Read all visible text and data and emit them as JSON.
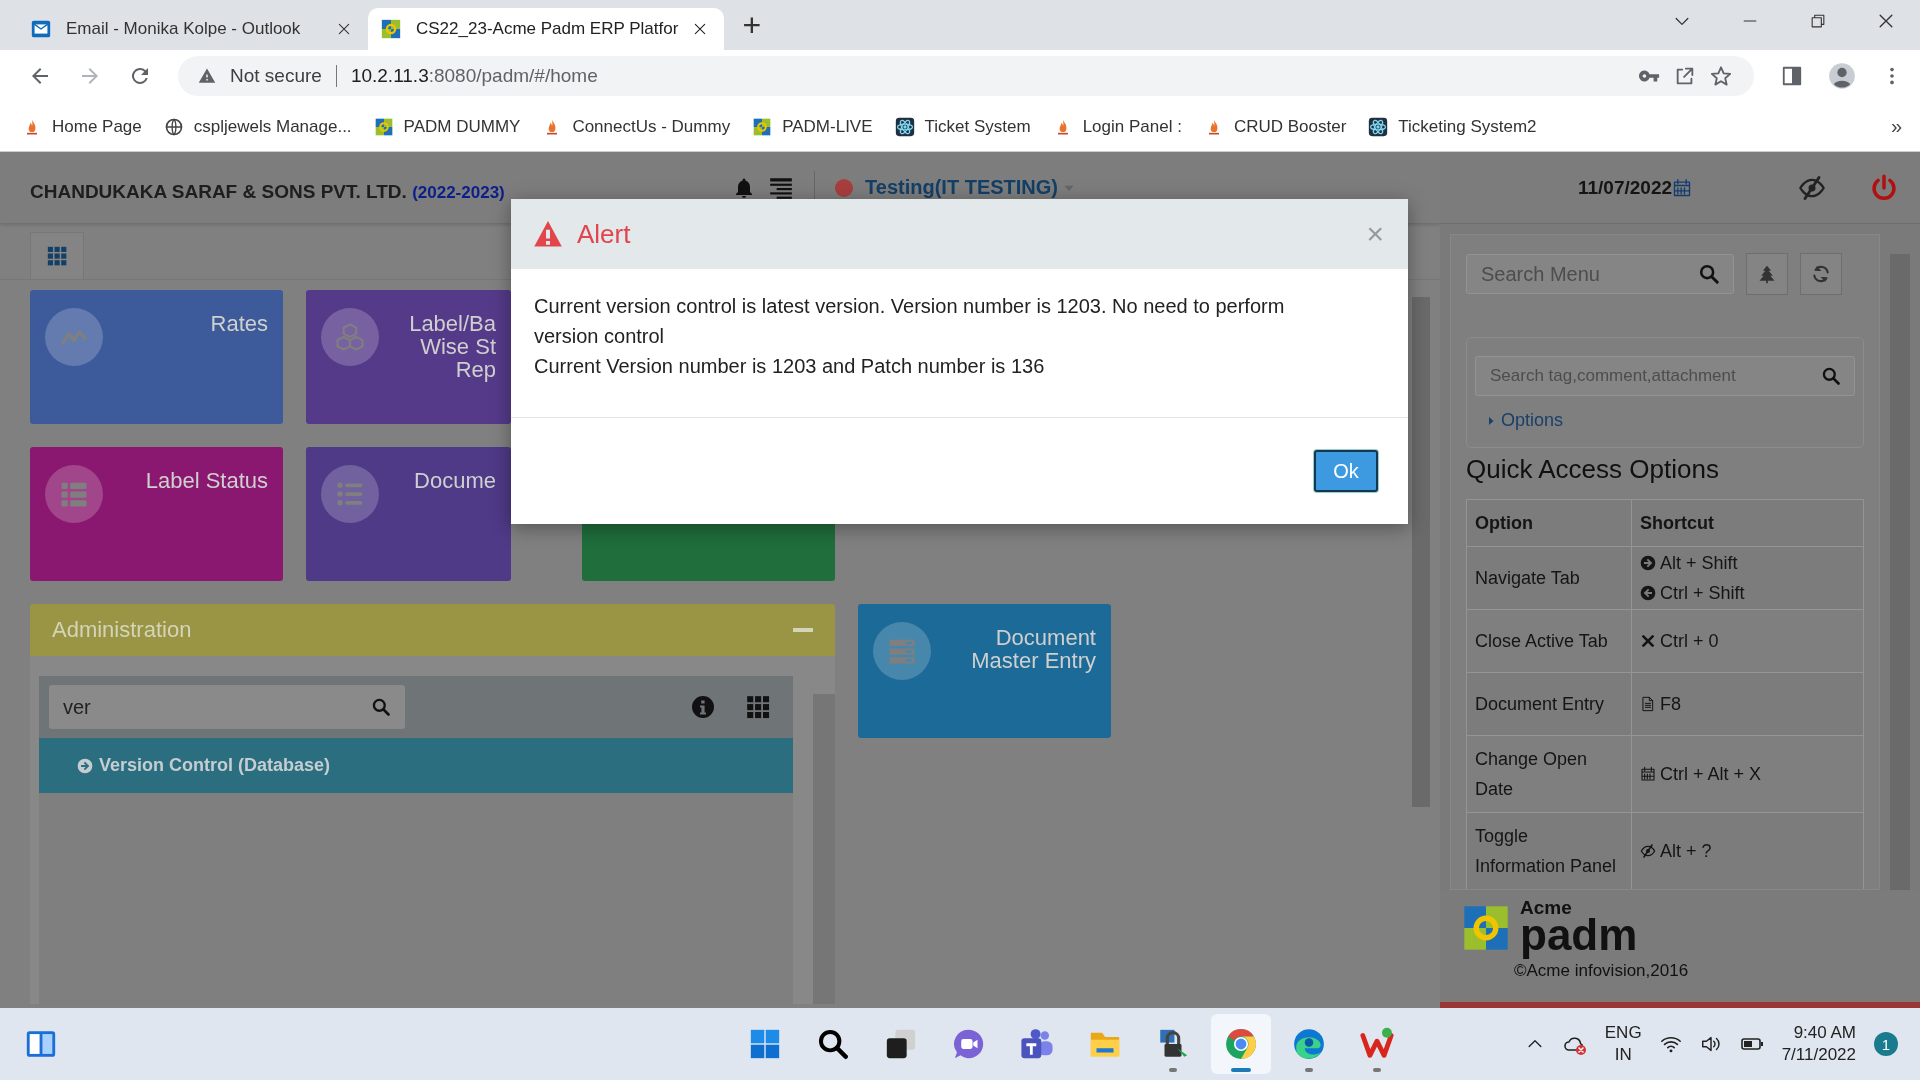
{
  "browser": {
    "tabs": [
      {
        "title": "Email - Monika Kolpe - Outlook",
        "kind": "mail",
        "selected": false
      },
      {
        "title": "CS22_23-Acme Padm ERP Platfor",
        "kind": "padm",
        "selected": true
      }
    ],
    "new_tab": "+",
    "security": "Not secure",
    "url_host": "10.2.11.3",
    "url_path": ":8080/padm/#/home",
    "bookmarks": [
      {
        "label": "Home Page",
        "kind": "flame"
      },
      {
        "label": "cspljewels Manage...",
        "kind": "globe"
      },
      {
        "label": "PADM DUMMY",
        "kind": "padm"
      },
      {
        "label": "ConnectUs - Dummy",
        "kind": "flame"
      },
      {
        "label": "PADM-LIVE",
        "kind": "padm"
      },
      {
        "label": "Ticket System",
        "kind": "atom"
      },
      {
        "label": "Login Panel :",
        "kind": "flame"
      },
      {
        "label": "CRUD Booster",
        "kind": "flame"
      },
      {
        "label": "Ticketing System2",
        "kind": "atom"
      }
    ],
    "more": "»"
  },
  "app": {
    "company": "CHANDUKAKA SARAF & SONS PVT. LTD.",
    "year": "(2022-2023)",
    "user": "Testing(IT TESTING)",
    "tile_rows": [
      [
        {
          "lines": [
            "Rates"
          ],
          "kind": "chart",
          "color": "#3d5b9a"
        },
        {
          "lines": [
            "Label/Ba",
            "Wise St",
            "Rep"
          ],
          "kind": "cubes",
          "color": "#553a89"
        }
      ],
      [
        {
          "lines": [
            "Label Status"
          ],
          "kind": "table",
          "color": "#8b1870"
        },
        {
          "lines": [
            "Docume"
          ],
          "kind": "bullets",
          "color": "#4e3a86"
        },
        {
          "kind": "none",
          "color": "#1f6e3b"
        }
      ]
    ],
    "admin": {
      "title": "Administration",
      "search_value": "ver",
      "items": [
        {
          "label": "Version Control (Database)"
        }
      ]
    },
    "side_tile": {
      "lines": [
        "Document",
        "Master Entry"
      ],
      "kind": "server",
      "color": "#1b6a98"
    }
  },
  "side": {
    "date": "11/07/2022",
    "menu_placeholder": "Search Menu",
    "tag_placeholder": "Search tag,comment,attachment",
    "options": "Options",
    "heading": "Quick Access Options",
    "columns": [
      "Option",
      "Shortcut"
    ],
    "rows": [
      {
        "option": "Navigate Tab",
        "shortcuts": [
          {
            "kind": "arrow-right",
            "keys": "Alt + Shift"
          },
          {
            "kind": "arrow-left",
            "keys": "Ctrl + Shift"
          }
        ]
      },
      {
        "option": "Close Active Tab",
        "shortcuts": [
          {
            "kind": "times",
            "keys": "Ctrl + 0"
          }
        ]
      },
      {
        "option": "Document Entry",
        "shortcuts": [
          {
            "kind": "file",
            "keys": "F8"
          }
        ]
      },
      {
        "option": "Change Open Date",
        "shortcuts": [
          {
            "kind": "calendar",
            "keys": "Ctrl + Alt + X"
          }
        ]
      },
      {
        "option": "Toggle Information Panel",
        "shortcuts": [
          {
            "kind": "eye-slash",
            "keys": "Alt + ?"
          }
        ]
      }
    ],
    "logo_top": "Acme",
    "logo_main": "padm",
    "copyright": "©Acme infovision,2016"
  },
  "alert": {
    "title": "Alert",
    "close": "×",
    "message": [
      "Current version control is latest version. Version number is 1203. No need to perform version control",
      "Current Version number is 1203 and Patch number is 136"
    ],
    "button": "Ok"
  },
  "taskbar": {
    "apps": [
      {
        "kind": "start",
        "running": false,
        "selected": false
      },
      {
        "kind": "search",
        "running": false,
        "selected": false
      },
      {
        "kind": "taskview",
        "running": false,
        "selected": false
      },
      {
        "kind": "chat",
        "running": false,
        "selected": false
      },
      {
        "kind": "teams",
        "running": false,
        "selected": false
      },
      {
        "kind": "folder",
        "running": false,
        "selected": false
      },
      {
        "kind": "vpn",
        "running": true,
        "selected": false
      },
      {
        "kind": "chrome",
        "running": true,
        "selected": true
      },
      {
        "kind": "edge",
        "running": true,
        "selected": false
      },
      {
        "kind": "wps",
        "running": true,
        "selected": false
      }
    ],
    "lang": [
      "ENG",
      "IN"
    ],
    "time": "9:40 AM",
    "date": "7/11/2022",
    "notifications": "1"
  }
}
